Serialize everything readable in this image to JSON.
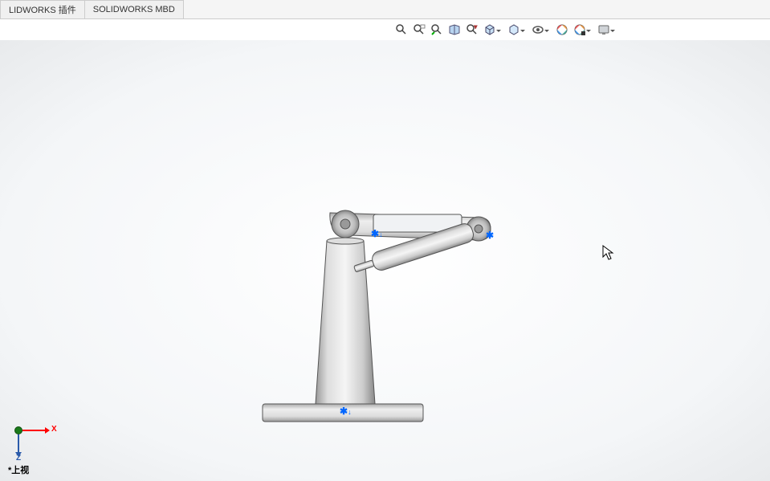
{
  "tabs": [
    {
      "label": "LIDWORKS 插件"
    },
    {
      "label": "SOLIDWORKS MBD"
    }
  ],
  "toolbar_icons": [
    {
      "name": "zoom-to-fit-icon",
      "dd": false
    },
    {
      "name": "zoom-to-area-icon",
      "dd": false
    },
    {
      "name": "previous-view-icon",
      "dd": false
    },
    {
      "name": "section-view-icon",
      "dd": false
    },
    {
      "name": "dynamic-annotation-icon",
      "dd": false
    },
    {
      "name": "view-orientation-icon",
      "dd": true
    },
    {
      "name": "display-style-icon",
      "dd": true
    },
    {
      "name": "hide-show-icon",
      "dd": true
    },
    {
      "name": "edit-appearance-icon",
      "dd": false
    },
    {
      "name": "apply-scene-icon",
      "dd": true
    },
    {
      "name": "view-settings-icon",
      "dd": true
    }
  ],
  "axes": {
    "x": "X",
    "z": "Z"
  },
  "view_label": "*上视"
}
